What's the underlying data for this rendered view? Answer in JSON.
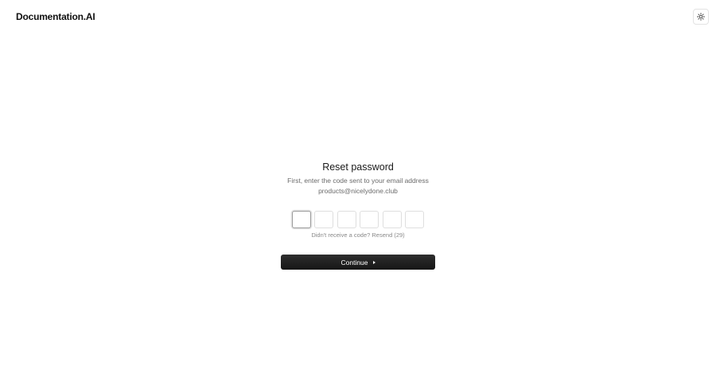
{
  "header": {
    "logo_text": "Documentation.AI",
    "theme_toggle_icon": "sun-icon"
  },
  "form": {
    "title": "Reset password",
    "subtitle": "First, enter the code sent to your email address",
    "email": "products@nicelydone.club",
    "code_length": 6,
    "code_values": [
      "",
      "",
      "",
      "",
      "",
      ""
    ],
    "resend_prefix": "Didn't receive a code?",
    "resend_label": "Resend (29)",
    "continue_label": "Continue",
    "continue_icon": "arrow-right-icon"
  },
  "colors": {
    "button_bg": "#1f1f1f",
    "text_primary": "#1a1a1a",
    "text_muted": "#6b6b6b"
  }
}
